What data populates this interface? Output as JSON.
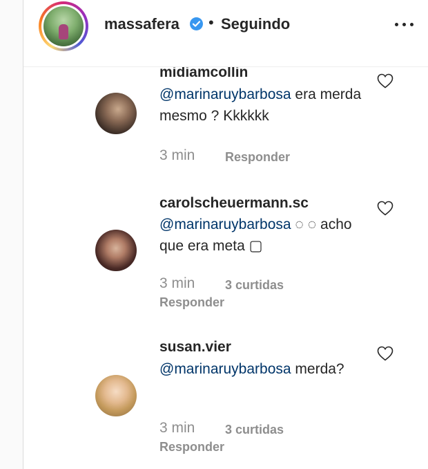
{
  "header": {
    "username": "massafera",
    "separator": "•",
    "follow_status": "Seguindo"
  },
  "comments": [
    {
      "username": "midiamcollin",
      "mention": "@marinaruybarbosa",
      "text_after_mention": " era merda mesmo ? Kkkkkk",
      "time": "3 min",
      "reply_label": "Responder"
    },
    {
      "username": "carolscheuermann.sc",
      "mention": "@marinaruybarbosa",
      "text_after_mention": " ◌ ◌ acho que era meta ▢",
      "time": "3 min",
      "likes_label": "3 curtidas",
      "reply_label": "Responder"
    },
    {
      "username": "susan.vier",
      "mention": "@marinaruybarbosa",
      "text_after_mention": " merda?",
      "time": "3 min",
      "likes_label": "3 curtidas",
      "reply_label": "Responder"
    }
  ],
  "icons": {
    "verified": "verified-badge-icon",
    "more": "more-options-icon",
    "like": "heart-outline-icon"
  },
  "colors": {
    "text": "#262626",
    "secondary": "#8e8e8e",
    "mention": "#003569",
    "verified": "#3897f0"
  }
}
